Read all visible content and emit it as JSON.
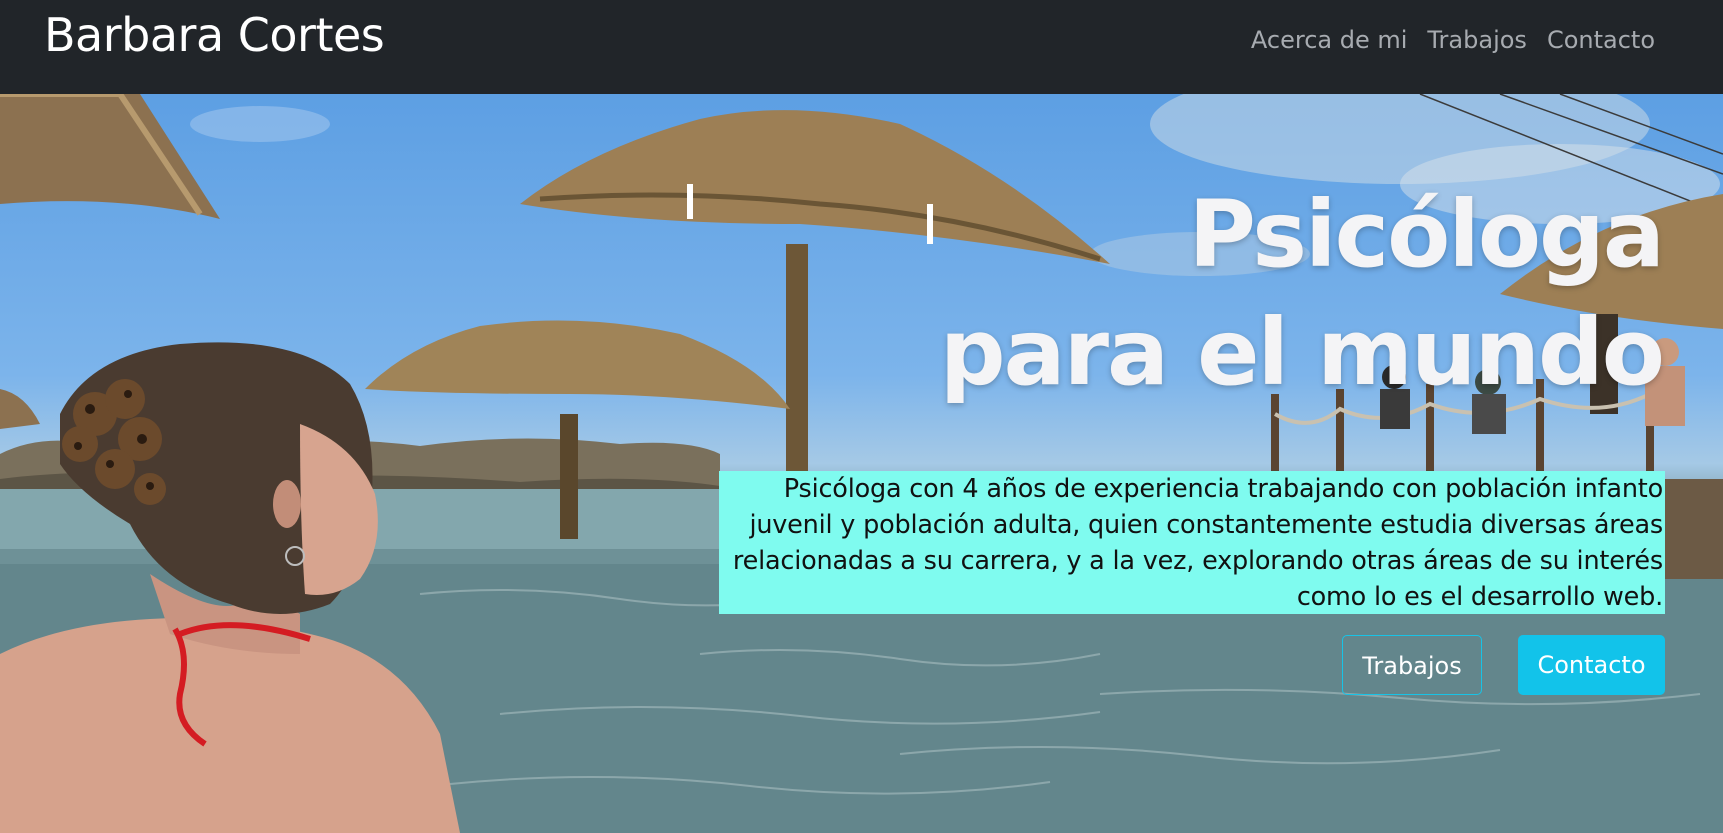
{
  "navbar": {
    "brand": "Barbara Cortes",
    "links": [
      {
        "label": "Acerca de mi"
      },
      {
        "label": "Trabajos"
      },
      {
        "label": "Contacto"
      }
    ]
  },
  "hero": {
    "headline_line1": "Psicóloga",
    "headline_line2": "para el mundo",
    "bio": "Psicóloga con 4 años de experiencia trabajando con población infanto juvenil y población adulta, quien constantemente estudia diversas áreas relacionadas a su carrera, y a la vez, explorando otras áreas de su interés como lo es el desarrollo web.",
    "buttons": {
      "trabajos_label": "Trabajos",
      "contacto_label": "Contacto"
    }
  },
  "colors": {
    "navbar_bg": "#212529",
    "bio_highlight": "#7ffbef",
    "accent": "#12c3ea"
  }
}
